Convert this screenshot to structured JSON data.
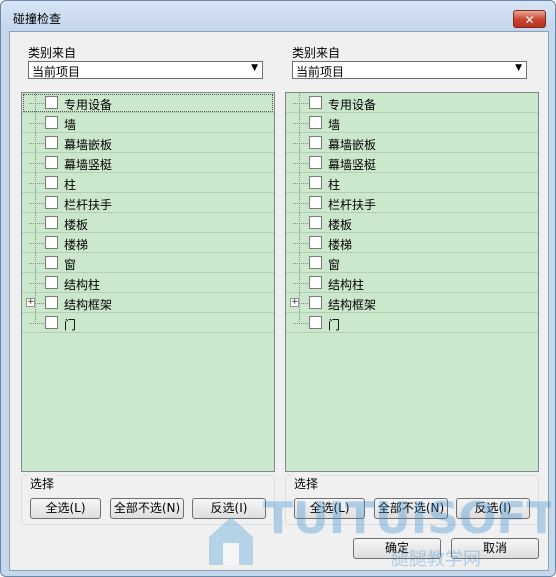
{
  "window": {
    "title": "碰撞检查",
    "close_label": "✕"
  },
  "left": {
    "group_label": "类别来自",
    "combo_value": "当前项目",
    "categories": [
      {
        "label": "专用设备",
        "expandable": false
      },
      {
        "label": "墙",
        "expandable": false
      },
      {
        "label": "幕墙嵌板",
        "expandable": false
      },
      {
        "label": "幕墙竖梃",
        "expandable": false
      },
      {
        "label": "柱",
        "expandable": false
      },
      {
        "label": "栏杆扶手",
        "expandable": false
      },
      {
        "label": "楼板",
        "expandable": false
      },
      {
        "label": "楼梯",
        "expandable": false
      },
      {
        "label": "窗",
        "expandable": false
      },
      {
        "label": "结构柱",
        "expandable": false
      },
      {
        "label": "结构框架",
        "expandable": true
      },
      {
        "label": "门",
        "expandable": false
      }
    ],
    "selection": {
      "title": "选择",
      "select_all": "全选(L)",
      "select_none": "全部不选(N)",
      "invert": "反选(I)"
    }
  },
  "right": {
    "group_label": "类别来自",
    "combo_value": "当前项目",
    "categories": [
      {
        "label": "专用设备",
        "expandable": false
      },
      {
        "label": "墙",
        "expandable": false
      },
      {
        "label": "幕墙嵌板",
        "expandable": false
      },
      {
        "label": "幕墙竖梃",
        "expandable": false
      },
      {
        "label": "柱",
        "expandable": false
      },
      {
        "label": "栏杆扶手",
        "expandable": false
      },
      {
        "label": "楼板",
        "expandable": false
      },
      {
        "label": "楼梯",
        "expandable": false
      },
      {
        "label": "窗",
        "expandable": false
      },
      {
        "label": "结构柱",
        "expandable": false
      },
      {
        "label": "结构框架",
        "expandable": true
      },
      {
        "label": "门",
        "expandable": false
      }
    ],
    "selection": {
      "title": "选择",
      "select_all": "全选(L)",
      "select_none": "全部不选(N)",
      "invert": "反选(I)"
    }
  },
  "footer": {
    "ok_label": "确定",
    "cancel_label": "取消"
  },
  "watermark": {
    "brand": "TUITUISOFT",
    "text": "腿腿教学网"
  }
}
